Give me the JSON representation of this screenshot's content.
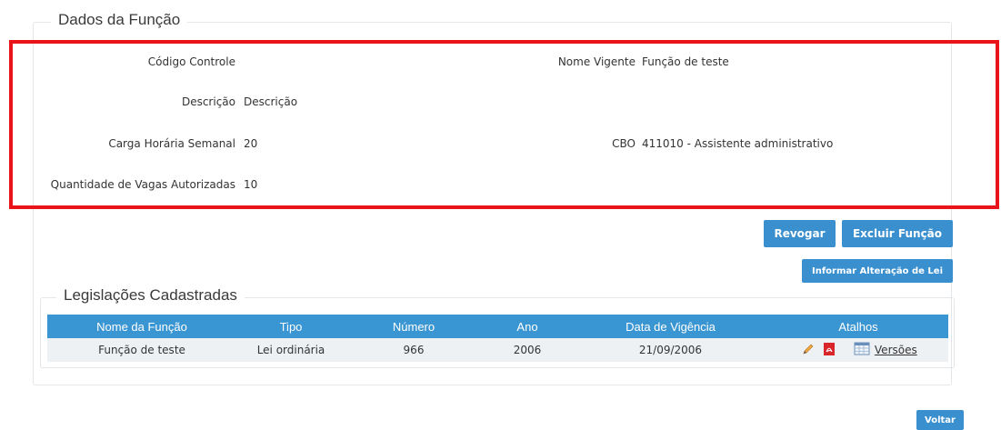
{
  "section_title": "Dados da Função",
  "fields": {
    "codigo_controle": {
      "label": "Código Controle",
      "value": ""
    },
    "nome_vigente": {
      "label": "Nome Vigente",
      "value": "Função de teste"
    },
    "descricao": {
      "label": "Descrição",
      "value": "Descrição"
    },
    "carga_horaria": {
      "label": "Carga Horária Semanal",
      "value": "20"
    },
    "cbo": {
      "label": "CBO",
      "value": "411010 - Assistente administrativo"
    },
    "quantidade_vagas": {
      "label": "Quantidade de Vagas Autorizadas",
      "value": "10"
    }
  },
  "buttons": {
    "revogar": "Revogar",
    "excluir": "Excluir Função",
    "informar": "Informar Alteração de Lei",
    "voltar": "Voltar"
  },
  "legislacoes": {
    "title": "Legislações Cadastradas",
    "columns": [
      "Nome da Função",
      "Tipo",
      "Número",
      "Ano",
      "Data de Vigência",
      "Atalhos"
    ],
    "rows": [
      {
        "nome": "Função de teste",
        "tipo": "Lei ordinária",
        "numero": "966",
        "ano": "2006",
        "data": "21/09/2006",
        "versoes": "Versões"
      }
    ]
  },
  "colors": {
    "accent": "#3a95d3",
    "highlight": "#e8141a"
  }
}
